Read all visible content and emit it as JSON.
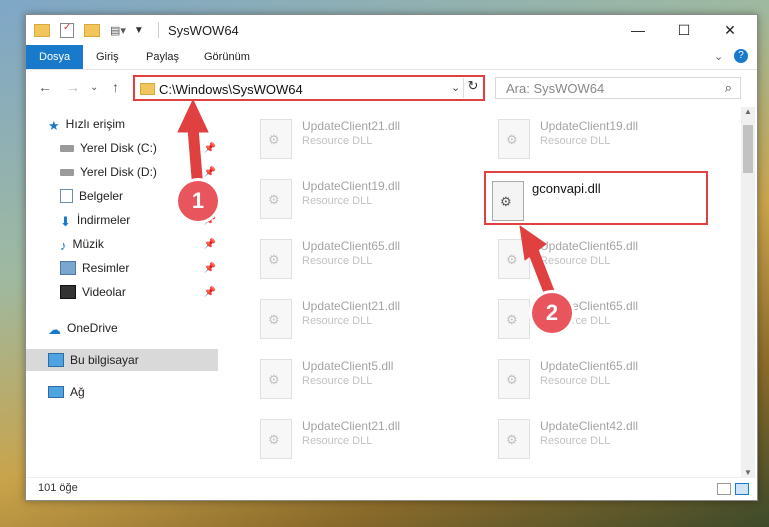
{
  "window": {
    "title": "SysWOW64",
    "controls": {
      "minimize": "—",
      "maximize": "☐",
      "close": "✕"
    }
  },
  "ribbon": {
    "tabs": [
      "Dosya",
      "Giriş",
      "Paylaş",
      "Görünüm"
    ]
  },
  "address": {
    "path": "C:\\Windows\\SysWOW64",
    "search_placeholder": "Ara: SysWOW64"
  },
  "navpane": {
    "items": [
      {
        "label": "Hızlı erişim",
        "icon": "star-icon"
      },
      {
        "label": "Yerel Disk (C:)",
        "icon": "drive-icon"
      },
      {
        "label": "Yerel Disk (D:)",
        "icon": "drive-icon"
      },
      {
        "label": "Belgeler",
        "icon": "documents-icon"
      },
      {
        "label": "İndirmeler",
        "icon": "download-icon"
      },
      {
        "label": "Müzik",
        "icon": "music-icon"
      },
      {
        "label": "Resimler",
        "icon": "pictures-icon"
      },
      {
        "label": "Videolar",
        "icon": "videos-icon"
      },
      {
        "label": "OneDrive",
        "icon": "cloud-icon"
      },
      {
        "label": "Bu bilgisayar",
        "icon": "computer-icon"
      },
      {
        "label": "Ağ",
        "icon": "network-icon"
      }
    ]
  },
  "files": {
    "left": [
      {
        "name": "UpdateClient21.dll",
        "desc": "Resource DLL"
      },
      {
        "name": "UpdateClient19.dll",
        "desc": "Resource DLL"
      },
      {
        "name": "UpdateClient65.dll",
        "desc": "Resource DLL"
      },
      {
        "name": "UpdateClient21.dll",
        "desc": "Resource DLL"
      },
      {
        "name": "UpdateClient5.dll",
        "desc": "Resource DLL"
      },
      {
        "name": "UpdateClient21.dll",
        "desc": "Resource DLL"
      }
    ],
    "right": [
      {
        "name": "UpdateClient19.dll",
        "desc": "Resource DLL"
      },
      {
        "name": "UpdateClient65.dll",
        "desc": "Resource DLL"
      },
      {
        "name": "UpdateClient65.dll",
        "desc": "Resource DLL"
      },
      {
        "name": "UpdateClient65.dll",
        "desc": "Resource DLL"
      },
      {
        "name": "UpdateClient42.dll",
        "desc": "Resource DLL"
      }
    ],
    "highlighted": {
      "name": "gconvapi.dll"
    }
  },
  "status": {
    "count": "101 öğe"
  },
  "annotations": [
    "1",
    "2"
  ],
  "colors": {
    "accent": "#1979ca",
    "highlight": "#e04040",
    "annotation": "#e8555c"
  }
}
